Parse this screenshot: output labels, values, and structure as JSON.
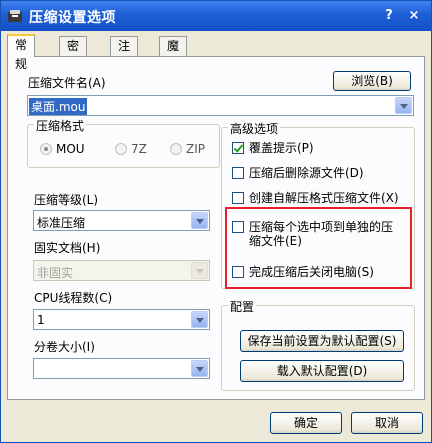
{
  "window": {
    "title": "压缩设置选项",
    "help": "?",
    "close": "×"
  },
  "tabs": [
    "常规",
    "密码",
    "注释",
    "魔页"
  ],
  "archive": {
    "label": "压缩文件名(A)",
    "browse": "浏览(B)",
    "value": "桌面.mou"
  },
  "format": {
    "title": "压缩格式",
    "options": [
      "MOU",
      "7Z",
      "ZIP"
    ],
    "selected": "MOU"
  },
  "level": {
    "label": "压缩等级(L)",
    "value": "标准压缩"
  },
  "solid": {
    "label": "固实文档(H)",
    "value": "非固实"
  },
  "threads": {
    "label": "CPU线程数(C)",
    "value": "1"
  },
  "volume": {
    "label": "分卷大小(I)",
    "value": ""
  },
  "advanced": {
    "title": "高级选项",
    "items": [
      {
        "label": "覆盖提示(P)",
        "checked": true
      },
      {
        "label": "压缩后删除源文件(D)",
        "checked": false
      },
      {
        "label": "创建自解压格式压缩文件(X)",
        "checked": false
      },
      {
        "label": "压缩每个选中项到单独的压缩文件(E)",
        "checked": false
      },
      {
        "label": "完成压缩后关闭电脑(S)",
        "checked": false
      }
    ]
  },
  "config": {
    "title": "配置",
    "save": "保存当前设置为默认配置(S)",
    "load": "载入默认配置(D)"
  },
  "footer": {
    "ok": "确定",
    "cancel": "取消"
  }
}
